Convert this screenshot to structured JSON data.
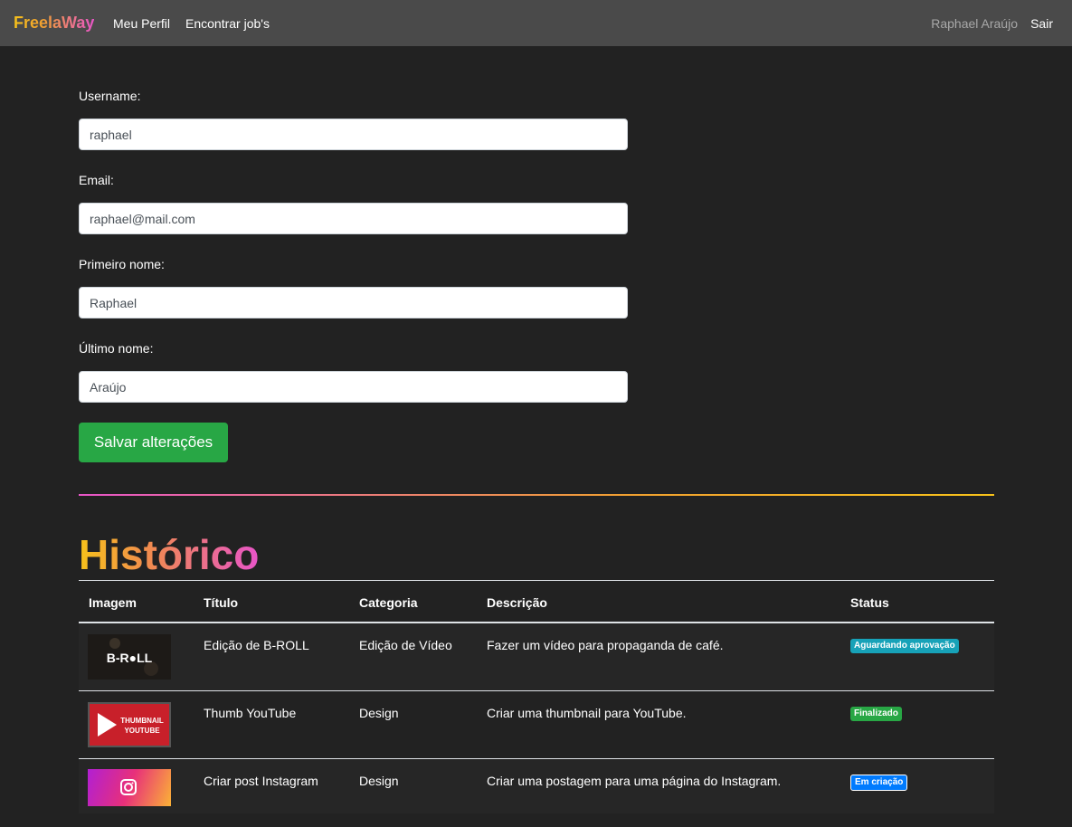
{
  "nav": {
    "brand": "FreelaWay",
    "links": [
      "Meu Perfil",
      "Encontrar job's"
    ],
    "user": "Raphael Araújo",
    "logout": "Sair"
  },
  "form": {
    "username_label": "Username:",
    "username_value": "raphael",
    "email_label": "Email:",
    "email_value": "raphael@mail.com",
    "first_name_label": "Primeiro nome:",
    "first_name_value": "Raphael",
    "last_name_label": "Último nome:",
    "last_name_value": "Araújo",
    "save_label": "Salvar alterações"
  },
  "history": {
    "title": "Histórico",
    "columns": [
      "Imagem",
      "Título",
      "Categoria",
      "Descrição",
      "Status"
    ],
    "rows": [
      {
        "thumb_text": "B-R●LL",
        "title": "Edição de B-ROLL",
        "category": "Edição de Vídeo",
        "description": "Fazer um vídeo para propaganda de café.",
        "status": "Aguardando aprovação",
        "status_color": "#17a2b8"
      },
      {
        "thumb_text_1": "THUMBNAIL",
        "thumb_text_2": "YOUTUBE",
        "title": "Thumb YouTube",
        "category": "Design",
        "description": "Criar uma thumbnail para YouTube.",
        "status": "Finalizado",
        "status_color": "#28a745"
      },
      {
        "title": "Criar post Instagram",
        "category": "Design",
        "description": "Criar uma postagem para uma página do Instagram.",
        "status": "Em criação",
        "status_color": "#007bff"
      }
    ]
  },
  "colors": {
    "background": "#222222",
    "navbar": "#4a4a4a",
    "save_button": "#28a745",
    "gradient_pink": "#e855c8",
    "gradient_yellow": "#f7c21a"
  }
}
